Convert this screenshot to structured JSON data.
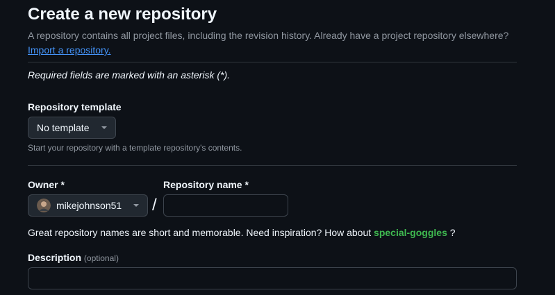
{
  "header": {
    "title": "Create a new repository",
    "subtitle": "A repository contains all project files, including the revision history. Already have a project repository elsewhere?",
    "import_link": "Import a repository."
  },
  "required_note": "Required fields are marked with an asterisk (*).",
  "template": {
    "label": "Repository template",
    "selected": "No template",
    "hint": "Start your repository with a template repository's contents."
  },
  "owner": {
    "label": "Owner *",
    "selected": "mikejohnson51"
  },
  "separator": "/",
  "repo_name": {
    "label": "Repository name *",
    "value": "",
    "placeholder": ""
  },
  "inspiration": {
    "text": "Great repository names are short and memorable. Need inspiration? How about",
    "suggestion": "special-goggles",
    "suffix": "?"
  },
  "description": {
    "label": "Description",
    "optional": "(optional)",
    "value": ""
  },
  "colors": {
    "background": "#0d1117",
    "link": "#4493f8",
    "suggestion": "#3fb950",
    "muted": "#9198a1"
  },
  "icons": {
    "dropdown": "triangle-down-icon",
    "avatar": "user-avatar"
  }
}
